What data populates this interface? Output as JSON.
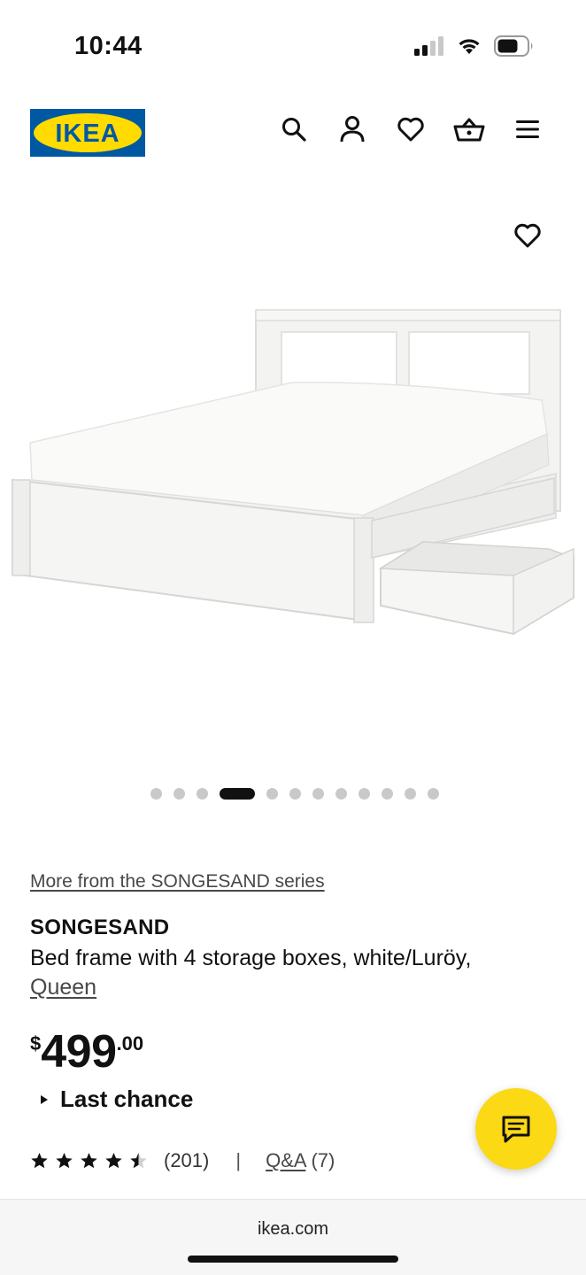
{
  "status_bar": {
    "time": "10:44"
  },
  "header": {
    "logo_text": "IKEA",
    "brand_colors": {
      "blue": "#0058A3",
      "yellow": "#FFDB00"
    },
    "icons": [
      "search-icon",
      "account-icon",
      "heart-icon",
      "cart-icon",
      "menu-icon"
    ]
  },
  "gallery": {
    "image_count": 12,
    "active_index": 3
  },
  "product": {
    "series_link": "More from the SONGESAND series",
    "name": "SONGESAND",
    "description": "Bed frame with 4 storage boxes, white/Luröy,",
    "size": "Queen",
    "price": {
      "currency": "$",
      "integer": "499",
      "decimal": ".00"
    },
    "badge": "Last chance",
    "rating": {
      "stars": 4.5,
      "count": "(201)",
      "separator": "|",
      "qa_label": "Q&A",
      "qa_count": " (7)"
    }
  },
  "chat": {
    "accent": "#FBD914"
  },
  "browser": {
    "url": "ikea.com"
  }
}
